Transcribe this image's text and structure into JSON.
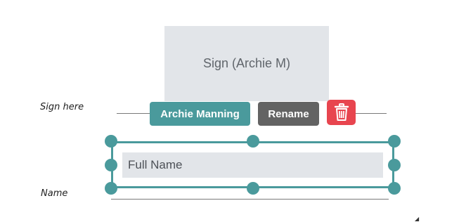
{
  "signature_field": {
    "placeholder": "Sign (Archie M)"
  },
  "labels": {
    "sign_here": "Sign here",
    "name": "Name"
  },
  "toolbar": {
    "signer_label": "Archie Manning",
    "rename_label": "Rename",
    "delete_icon": "trash-icon"
  },
  "name_field": {
    "placeholder": "Full Name",
    "value": ""
  },
  "colors": {
    "accent": "#4a9a9c",
    "rename_button": "#636363",
    "delete_button": "#e8454f",
    "field_background": "#e2e5e9"
  }
}
